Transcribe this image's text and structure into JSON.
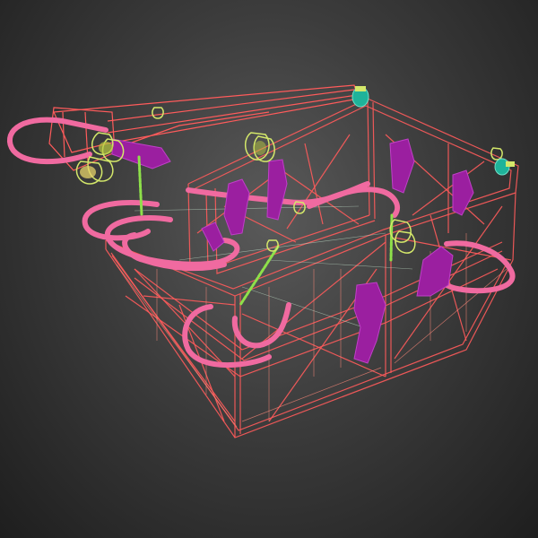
{
  "viewport": {
    "view_mode": "wireframe",
    "background": "#3c3c3c"
  },
  "model": {
    "subject": "cage",
    "colors": {
      "frame": "#ff5b5b",
      "frame_light": "#ff8a7a",
      "hooks": "#f06aa0",
      "clamps": "#9b1fa0",
      "chains": "#8ee04a",
      "hinges": "#d4e86a",
      "fittings": "#1fb39a",
      "guides": "#c8e8d0"
    }
  }
}
